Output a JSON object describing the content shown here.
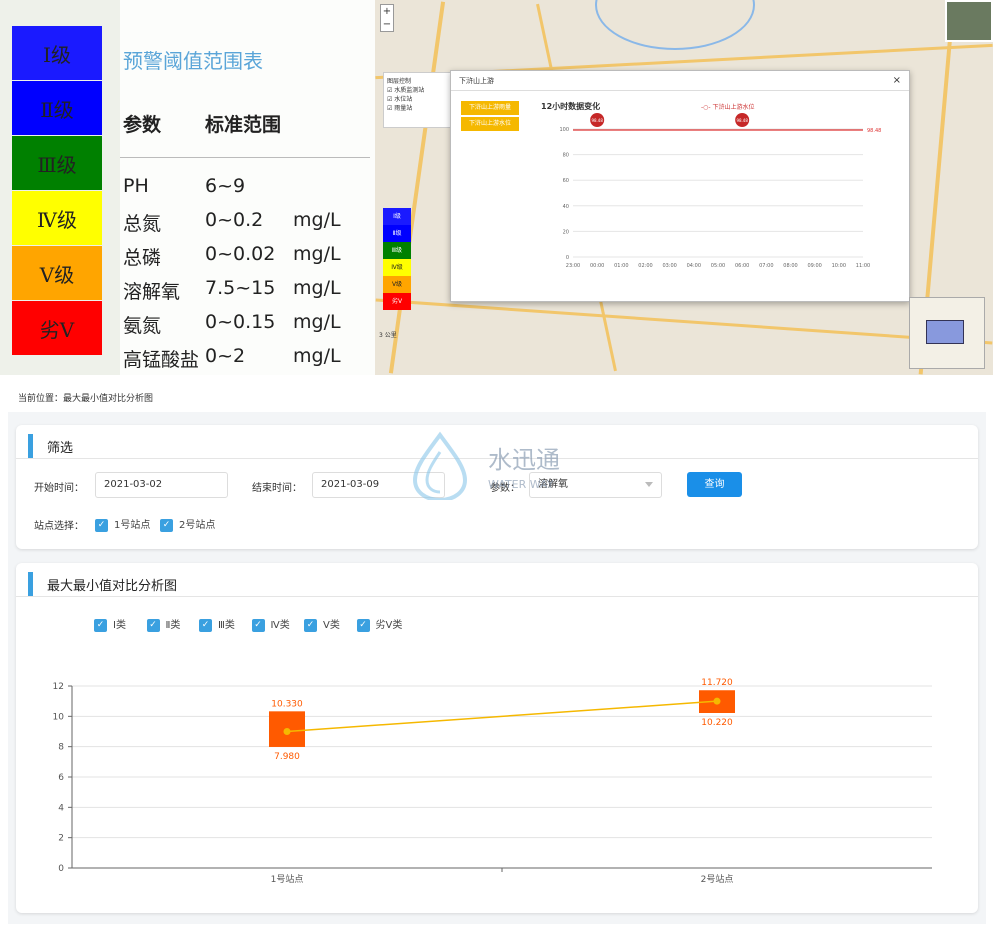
{
  "levels": [
    {
      "label": "Ⅰ级",
      "color": "#1a1aff"
    },
    {
      "label": "Ⅱ级",
      "color": "#0000ff"
    },
    {
      "label": "Ⅲ级",
      "color": "#008000"
    },
    {
      "label": "Ⅳ级",
      "color": "#ffff00"
    },
    {
      "label": "Ⅴ级",
      "color": "#ffa500"
    },
    {
      "label": "劣Ⅴ",
      "color": "#ff0000"
    }
  ],
  "threshold": {
    "title": "预警阈值范围表",
    "col_param": "参数",
    "col_range": "标准范围",
    "rows": [
      {
        "param": "PH",
        "range": "6~9",
        "unit": ""
      },
      {
        "param": "总氮",
        "range": "0~0.2",
        "unit": "mg/L"
      },
      {
        "param": "总磷",
        "range": "0~0.02",
        "unit": "mg/L"
      },
      {
        "param": "溶解氧",
        "range": "7.5~15",
        "unit": "mg/L"
      },
      {
        "param": "氨氮",
        "range": "0~0.15",
        "unit": "mg/L"
      },
      {
        "param": "高锰酸盐",
        "range": "0~2",
        "unit": "mg/L"
      }
    ]
  },
  "map": {
    "layer_title": "图层控制",
    "layers": [
      "水质监测站",
      "水位站",
      "雨量站"
    ],
    "popup_title": "下浒山上游",
    "popup_btn1": "下浒山上游雨量",
    "popup_btn2": "下浒山上游水位",
    "popup_chart_title": "12小时数据变化",
    "popup_series": "下浒山上游水位",
    "popup_hours": [
      "23:00",
      "00:00",
      "01:00",
      "02:00",
      "03:00",
      "04:00",
      "05:00",
      "06:00",
      "07:00",
      "08:00",
      "09:00",
      "10:00",
      "11:00"
    ],
    "popup_value": "98.48",
    "popup_y_ticks": [
      "100",
      "80",
      "60",
      "40",
      "20",
      "0"
    ],
    "thumb_label": "卫星",
    "scale": "3 公里"
  },
  "breadcrumb": "当前位置：最大最小值对比分析图",
  "filter": {
    "title": "筛选",
    "start_label": "开始时间：",
    "start_value": "2021-03-02",
    "end_label": "结束时间：",
    "end_value": "2021-03-09",
    "param_label": "参数：",
    "param_value": "溶解氧",
    "query": "查询",
    "station_label": "站点选择：",
    "stations": [
      "1号站点",
      "2号站点"
    ]
  },
  "watermark": {
    "cn": "水迅通",
    "en": "WATER WAY"
  },
  "chart_card": {
    "title": "最大最小值对比分析图",
    "classes": [
      "Ⅰ类",
      "Ⅱ类",
      "Ⅲ类",
      "Ⅳ类",
      "Ⅴ类",
      "劣Ⅴ类"
    ]
  },
  "chart_data": {
    "type": "candlestick",
    "categories": [
      "1号站点",
      "2号站点"
    ],
    "max": [
      10.33,
      11.72
    ],
    "min": [
      7.98,
      10.22
    ],
    "avg": [
      9.0,
      11.0
    ],
    "max_labels": [
      "10.330",
      "11.720"
    ],
    "min_labels": [
      "7.980",
      "10.220"
    ],
    "ylim": [
      0,
      12
    ],
    "yticks": [
      0,
      2,
      4,
      6,
      8,
      10,
      12
    ],
    "box_color": "#ff5a00",
    "line_color": "#f5b800",
    "grid": true
  }
}
